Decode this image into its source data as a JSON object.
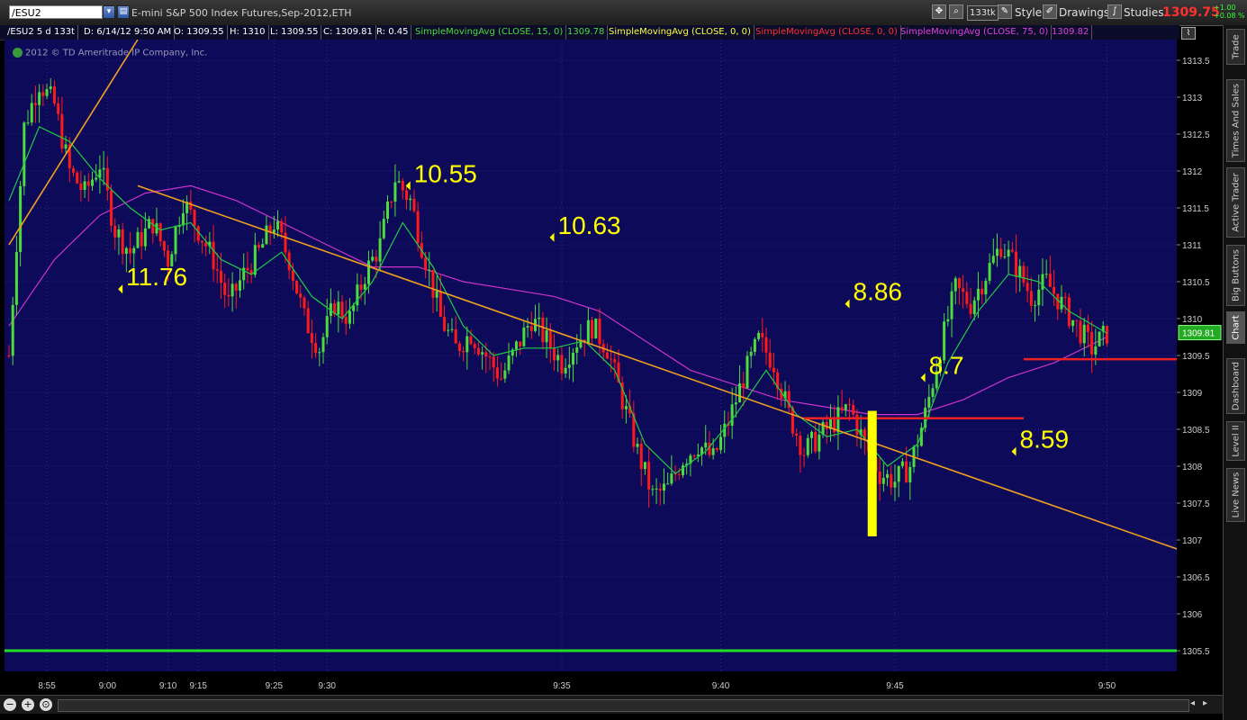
{
  "toolbar": {
    "symbol": "/ESU2",
    "description": "E-mini S&P 500 Index Futures,Sep-2012,ETH",
    "aggregation": "133tk",
    "style_label": "Style",
    "drawings_label": "Drawings",
    "studies_label": "Studies",
    "last_price": "1309.75",
    "change_abs": "+1.00",
    "change_pct": "+0.08 %"
  },
  "infobar": {
    "symbol_period": "/ESU2 5 d 133t",
    "date": "D: 6/14/12 9:50 AM",
    "open": "O: 1309.55",
    "high": "H: 1310",
    "low": "L: 1309.55",
    "close": "C: 1309.81",
    "range": "R: 0.45",
    "sma15_label": "SimpleMovingAvg (CLOSE, 15, 0)",
    "sma15_value": "1309.78",
    "sma0_label": "SimpleMovingAvg (CLOSE, 0, 0)",
    "sma0b_label": "SimpleMovingAvg (CLOSE, 0, 0)",
    "sma75_label": "SimpleMovingAvg (CLOSE, 75, 0)",
    "sma75_value": "1309.82"
  },
  "copyright": "2012 © TD Ameritrade IP Company, Inc.",
  "sidebar": [
    "Trade",
    "Times And Sales",
    "Active Trader",
    "Big Buttons",
    "Chart",
    "Dashboard",
    "Level II",
    "Live News"
  ],
  "colors": {
    "background": "#0d0a5a",
    "up_bar": "#4ddc3c",
    "down_bar": "#ff1a1a",
    "sma15": "#22cc44",
    "sma75": "#cc33cc",
    "trendline": "#f0a020",
    "annotation": "#ffff00",
    "level_line": "#ee2222",
    "baseline": "#22dd22"
  },
  "chart_data": {
    "type": "candlestick",
    "y_ticks": [
      1305.5,
      1306,
      1306.5,
      1307,
      1307.5,
      1308,
      1308.5,
      1309,
      1309.5,
      1310,
      1310.5,
      1311,
      1311.5,
      1312,
      1312.5,
      1313,
      1313.5
    ],
    "ylim": [
      1305.22,
      1313.78
    ],
    "x_ticks": [
      "8:55",
      "9:00",
      "9:10",
      "9:15",
      "9:25",
      "9:30",
      "9:35",
      "9:40",
      "9:45",
      "9:50"
    ],
    "last_price_label": "1309.81",
    "price_path": [
      [
        0,
        1309.5
      ],
      [
        2,
        1312.6
      ],
      [
        4,
        1313.2
      ],
      [
        6,
        1312.9
      ],
      [
        8,
        1312.0
      ],
      [
        10,
        1311.7
      ],
      [
        12,
        1312.1
      ],
      [
        14,
        1311.2
      ],
      [
        16,
        1310.9
      ],
      [
        19,
        1311.3
      ],
      [
        21,
        1310.8
      ],
      [
        23,
        1311.6
      ],
      [
        25,
        1311.2
      ],
      [
        27,
        1310.8
      ],
      [
        29,
        1310.2
      ],
      [
        31,
        1310.6
      ],
      [
        33,
        1310.9
      ],
      [
        35,
        1311.3
      ],
      [
        37,
        1310.8
      ],
      [
        39,
        1310.0
      ],
      [
        41,
        1309.6
      ],
      [
        43,
        1310.2
      ],
      [
        45,
        1310.0
      ],
      [
        47,
        1310.6
      ],
      [
        49,
        1311.0
      ],
      [
        51,
        1311.9
      ],
      [
        53,
        1311.6
      ],
      [
        55,
        1310.8
      ],
      [
        57,
        1310.0
      ],
      [
        59,
        1309.6
      ],
      [
        61,
        1309.8
      ],
      [
        63,
        1309.5
      ],
      [
        65,
        1309.2
      ],
      [
        67,
        1309.6
      ],
      [
        69,
        1310.0
      ],
      [
        71,
        1309.7
      ],
      [
        73,
        1309.4
      ],
      [
        75,
        1309.7
      ],
      [
        77,
        1309.9
      ],
      [
        79,
        1309.6
      ],
      [
        81,
        1308.9
      ],
      [
        83,
        1308.2
      ],
      [
        85,
        1307.6
      ],
      [
        87,
        1307.7
      ],
      [
        89,
        1308.1
      ],
      [
        91,
        1308.3
      ],
      [
        93,
        1308.1
      ],
      [
        95,
        1308.6
      ],
      [
        97,
        1309.2
      ],
      [
        99,
        1309.7
      ],
      [
        101,
        1309.4
      ],
      [
        103,
        1308.7
      ],
      [
        105,
        1308.2
      ],
      [
        107,
        1308.4
      ],
      [
        109,
        1308.6
      ],
      [
        111,
        1308.8
      ],
      [
        113,
        1308.3
      ],
      [
        115,
        1307.9
      ],
      [
        117,
        1307.8
      ],
      [
        119,
        1308.0
      ],
      [
        121,
        1308.7
      ],
      [
        123,
        1309.6
      ],
      [
        125,
        1310.4
      ],
      [
        127,
        1310.2
      ],
      [
        129,
        1310.6
      ],
      [
        131,
        1311.0
      ],
      [
        133,
        1310.7
      ],
      [
        135,
        1310.3
      ],
      [
        137,
        1310.5
      ],
      [
        139,
        1310.2
      ],
      [
        141,
        1309.9
      ],
      [
        143,
        1309.6
      ],
      [
        145,
        1309.8
      ]
    ],
    "sma15_path": [
      [
        0,
        1311.6
      ],
      [
        4,
        1312.6
      ],
      [
        8,
        1312.4
      ],
      [
        12,
        1311.9
      ],
      [
        16,
        1311.5
      ],
      [
        20,
        1311.2
      ],
      [
        24,
        1311.3
      ],
      [
        28,
        1310.8
      ],
      [
        32,
        1310.6
      ],
      [
        36,
        1310.9
      ],
      [
        40,
        1310.3
      ],
      [
        44,
        1310.0
      ],
      [
        48,
        1310.5
      ],
      [
        52,
        1311.3
      ],
      [
        56,
        1310.7
      ],
      [
        60,
        1309.9
      ],
      [
        64,
        1309.5
      ],
      [
        68,
        1309.6
      ],
      [
        72,
        1309.6
      ],
      [
        76,
        1309.7
      ],
      [
        80,
        1309.3
      ],
      [
        84,
        1308.3
      ],
      [
        88,
        1307.9
      ],
      [
        92,
        1308.2
      ],
      [
        96,
        1308.7
      ],
      [
        100,
        1309.3
      ],
      [
        104,
        1308.7
      ],
      [
        108,
        1308.4
      ],
      [
        112,
        1308.5
      ],
      [
        116,
        1308.0
      ],
      [
        120,
        1308.3
      ],
      [
        124,
        1309.4
      ],
      [
        128,
        1310.1
      ],
      [
        132,
        1310.6
      ],
      [
        136,
        1310.5
      ],
      [
        140,
        1310.1
      ],
      [
        145,
        1309.8
      ]
    ],
    "sma75_path": [
      [
        0,
        1309.9
      ],
      [
        6,
        1310.8
      ],
      [
        12,
        1311.4
      ],
      [
        18,
        1311.7
      ],
      [
        24,
        1311.8
      ],
      [
        30,
        1311.6
      ],
      [
        36,
        1311.3
      ],
      [
        42,
        1311.0
      ],
      [
        48,
        1310.7
      ],
      [
        54,
        1310.7
      ],
      [
        60,
        1310.5
      ],
      [
        66,
        1310.4
      ],
      [
        72,
        1310.3
      ],
      [
        78,
        1310.1
      ],
      [
        84,
        1309.7
      ],
      [
        90,
        1309.3
      ],
      [
        96,
        1309.1
      ],
      [
        102,
        1308.9
      ],
      [
        108,
        1308.8
      ],
      [
        114,
        1308.7
      ],
      [
        120,
        1308.7
      ],
      [
        126,
        1308.9
      ],
      [
        132,
        1309.2
      ],
      [
        138,
        1309.4
      ],
      [
        145,
        1309.75
      ]
    ],
    "trendlines": [
      {
        "name": "up",
        "from": [
          0,
          1311.0
        ],
        "to": [
          17,
          1313.78
        ]
      },
      {
        "name": "down",
        "from": [
          17,
          1311.8
        ],
        "to": [
          169,
          1306.35
        ]
      }
    ],
    "levels": [
      {
        "price": 1308.65,
        "from": 105,
        "to": 134
      },
      {
        "price": 1309.45,
        "from": 134,
        "to": 169
      }
    ],
    "annotations": [
      {
        "text": "11.76",
        "x": 15,
        "price": 1310.4
      },
      {
        "text": "10.55",
        "x": 53,
        "price": 1311.8
      },
      {
        "text": "10.63",
        "x": 72,
        "price": 1311.1
      },
      {
        "text": "8.86",
        "x": 111,
        "price": 1310.2
      },
      {
        "text": "8.7",
        "x": 121,
        "price": 1309.2
      },
      {
        "text": "8.59",
        "x": 133,
        "price": 1308.2
      }
    ],
    "highlight_bar": {
      "x": 114,
      "from_price": 1307.05,
      "to_price": 1308.75
    },
    "baseline_price": 1305.5
  }
}
